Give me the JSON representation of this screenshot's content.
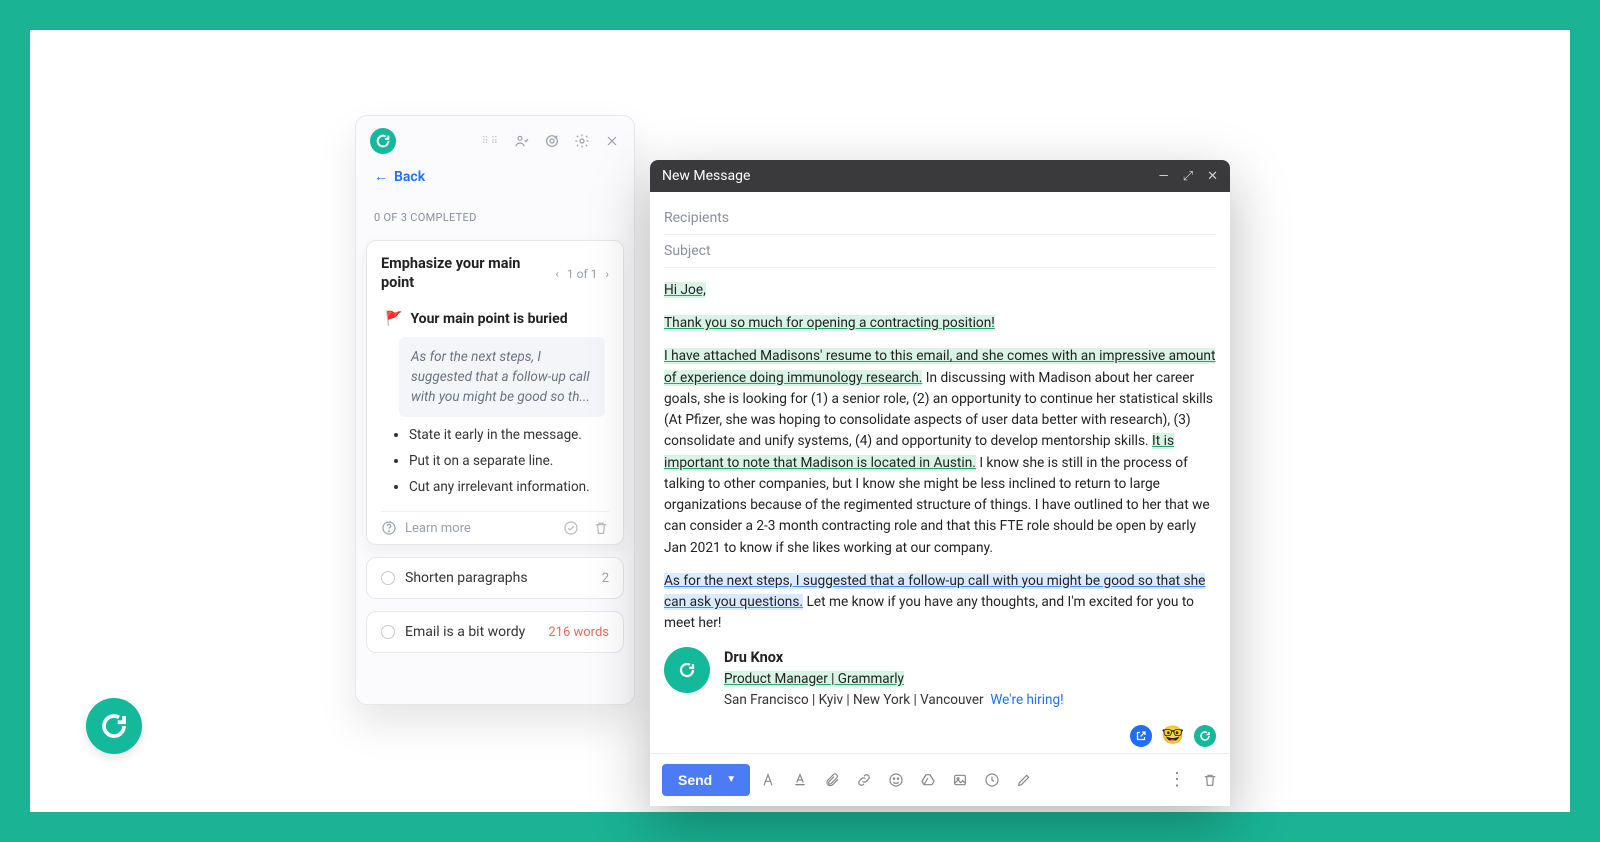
{
  "panel": {
    "back_label": "Back",
    "progress_text": "0 OF 3 COMPLETED",
    "card": {
      "title": "Emphasize your main point",
      "pager_text": "1 of 1",
      "subtitle": "Your main point is buried",
      "quote": "As for the next steps, I suggested that a follow-up call with you might be good so th...",
      "tips": [
        "State it early in the message.",
        "Put it on a separate line.",
        "Cut any irrelevant information."
      ],
      "learn_more": "Learn more"
    },
    "rows": [
      {
        "label": "Shorten paragraphs",
        "badge": "2",
        "badge_kind": "count"
      },
      {
        "label": "Email is a bit wordy",
        "badge": "216 words",
        "badge_kind": "words"
      }
    ]
  },
  "compose": {
    "title": "New Message",
    "recipients_label": "Recipients",
    "subject_label": "Subject",
    "greeting": "Hi Joe,",
    "thanks": "Thank you so much for opening a contracting position!",
    "para1_hl": "I have attached Madisons' resume to this email, and she comes with an impressive amount of experience doing immunology research.",
    "para1_rest_a": "In discussing with Madison about her career goals, she is looking for (1) a senior role, (2) an opportunity to continue her statistical skills (At Pfizer, she was hoping to consolidate aspects of user data better with research), (3) consolidate and unify systems, (4) and opportunity to develop mentorship skills. ",
    "para1_hl2": "It is important to note that Madison is located in Austin.",
    "para1_rest_b": " I know she is still in the process of talking to other companies, but I know she might be less inclined to return to large organizations because of the regimented structure of things. I have outlined to her that we can consider a 2-3 month contracting role and that this FTE role should be open by early Jan 2021 to know if she likes working at our company.",
    "para2_hl": "As for the next steps, I suggested that a follow-up call with you might be good so that she can ask you questions.",
    "para2_rest": " Let me know if you have any thoughts, and I'm excited for you to meet her!",
    "signature": {
      "name": "Dru Knox",
      "role": "Product Manager | Grammarly",
      "locations": "San Francisco | Kyiv | New York | Vancouver",
      "hiring": "We're hiring!"
    },
    "send_label": "Send",
    "emoji_badge": "🤓"
  }
}
